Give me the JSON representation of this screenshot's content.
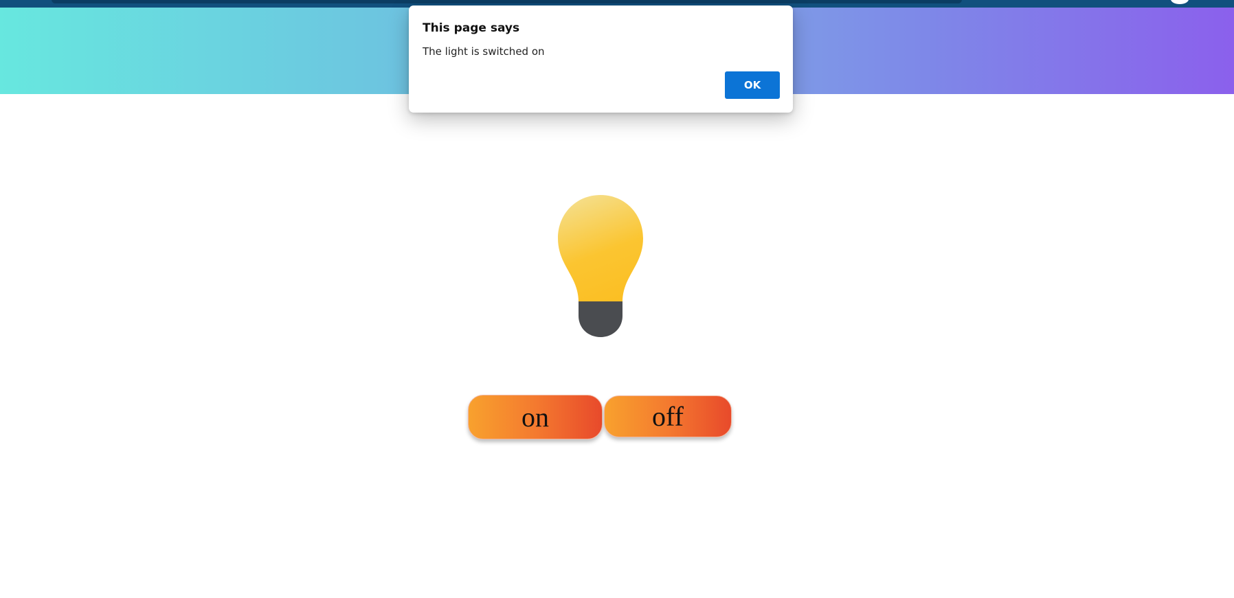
{
  "dialog": {
    "title": "This page says",
    "message": "The light is switched on",
    "ok_label": "OK"
  },
  "controls": {
    "on_label": "on",
    "off_label": "off"
  },
  "bulb": {
    "state": "on",
    "icon": "light-bulb-icon"
  },
  "colors": {
    "banner_start": "#67e7df",
    "banner_end": "#8b60ec",
    "button_start": "#f8a12e",
    "button_end": "#e84a2b",
    "dialog_button": "#0c74d6",
    "bulb_glass": "#fbc531",
    "bulb_base": "#4a4c50"
  }
}
